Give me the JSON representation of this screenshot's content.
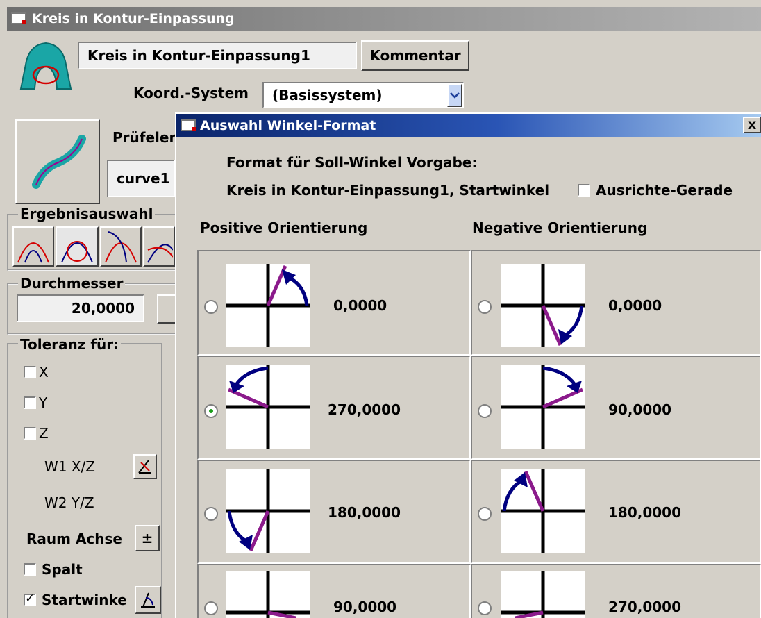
{
  "window": {
    "title": "Kreis in Kontur-Einpassung"
  },
  "main": {
    "name_value": "Kreis in Kontur-Einpassung1",
    "comment_button": "Kommentar",
    "coord_label": "Koord.-System",
    "coord_value": "(Basissystem)",
    "pruef_label": "Prüfelem",
    "curve_value": "curve1",
    "ergebnis_label": "Ergebnisauswahl",
    "durchmesser_label": "Durchmesser",
    "durchmesser_value": "20,0000",
    "toleranz_label": "Toleranz für:",
    "tol_items": [
      "X",
      "Y",
      "Z"
    ],
    "w1_label": "W1 X/Z",
    "w2_label": "W2 Y/Z",
    "raum_label": "Raum Achse",
    "raum_button": "±",
    "spalt_label": "Spalt",
    "startwinkel_label": "Startwinke"
  },
  "dialog": {
    "title": "Auswahl Winkel-Format",
    "close": "X",
    "heading": "Format für Soll-Winkel Vorgabe:",
    "subheading": "Kreis in Kontur-Einpassung1, Startwinkel",
    "ausrichte_label": "Ausrichte-Gerade",
    "pos_header": "Positive Orientierung",
    "neg_header": "Negative Orientierung",
    "positive": [
      "0,0000",
      "270,0000",
      "180,0000",
      "90,0000"
    ],
    "negative": [
      "0,0000",
      "90,0000",
      "180,0000",
      "270,0000"
    ],
    "selected": "positive-270"
  },
  "colors": {
    "accent": "#0a246a",
    "arrow": "#000080",
    "line": "#8b1a8b"
  }
}
